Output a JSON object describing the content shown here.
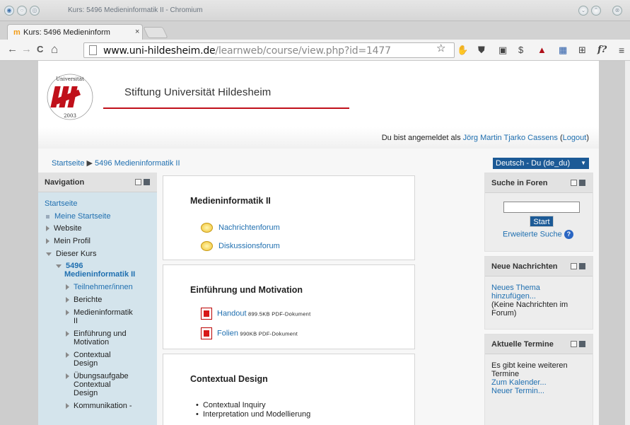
{
  "window": {
    "title": "Kurs: 5496 Medieninformatik II - Chromium",
    "buttons": [
      "○",
      "◎"
    ],
    "right_buttons": [
      "⌄",
      "⌃",
      "⊗"
    ]
  },
  "tab": {
    "favicon": "m",
    "title": "Kurs: 5496 Medieninform",
    "close": "×"
  },
  "toolbar": {
    "back": "←",
    "forward": "→",
    "reload": "C",
    "home": "⌂",
    "url_host": "www.uni-hildesheim.de",
    "url_path": "/learnweb/course/view.php?id=1477",
    "star": "☆",
    "extensions": [
      "✋",
      "⛊",
      "▣",
      "$",
      "▲",
      "▦",
      "⊞",
      "f?",
      "≡"
    ]
  },
  "header": {
    "logo_text": "Stiftung Universität Hildesheim 2003",
    "site_name": "Stiftung Universität Hildesheim"
  },
  "login": {
    "prefix": "Du bist angemeldet als ",
    "user": "Jörg Martin Tjarko Cassens",
    "logout_open": " (",
    "logout": "Logout",
    "logout_close": ")"
  },
  "breadcrumb": {
    "home": "Startseite",
    "separator": " ▶ ",
    "course": "5496 Medieninformatik II"
  },
  "language": {
    "selected": "Deutsch - Du (de_du)"
  },
  "navigation": {
    "title": "Navigation",
    "home": "Startseite",
    "items": [
      {
        "label": "Meine Startseite"
      },
      {
        "label": "Website"
      },
      {
        "label": "Mein Profil"
      },
      {
        "label": "Dieser Kurs"
      },
      {
        "label": "5496"
      },
      {
        "label": "Medieninformatik II"
      },
      {
        "label": "Teilnehmer/innen"
      },
      {
        "label": "Berichte"
      },
      {
        "label": "Medieninformatik"
      },
      {
        "label": "II"
      },
      {
        "label": "Einführung und"
      },
      {
        "label": "Motivation"
      },
      {
        "label": "Contextual"
      },
      {
        "label": "Design"
      },
      {
        "label": "Übungsaufgabe"
      },
      {
        "label": "Contextual"
      },
      {
        "label": "Design"
      },
      {
        "label": "Kommunikation -"
      }
    ]
  },
  "sections": {
    "s1": {
      "title": "Medieninformatik II",
      "forum1": "Nachrichtenforum",
      "forum2": "Diskussionsforum"
    },
    "s2": {
      "title": "Einführung und Motivation",
      "file1": "Handout",
      "file1_meta": " 899.5KB PDF-Dokument",
      "file2": "Folien",
      "file2_meta": " 990KB PDF-Dokument"
    },
    "s3": {
      "title": "Contextual Design",
      "bullet1": "Contextual Inquiry",
      "bullet2": "Interpretation und Modellierung"
    }
  },
  "search_forums": {
    "title": "Suche in Foren",
    "start": "Start",
    "advanced": "Erweiterte Suche",
    "help": "?"
  },
  "news": {
    "title": "Neue Nachrichten",
    "add1": "Neues Thema",
    "add2": "hinzufügen...",
    "none1": "(Keine Nachrichten im",
    "none2": "Forum)"
  },
  "events": {
    "title": "Aktuelle Termine",
    "none1": "Es gibt keine weiteren",
    "none2": "Termine",
    "calendar": "Zum Kalender...",
    "new": "Neuer Termin..."
  }
}
